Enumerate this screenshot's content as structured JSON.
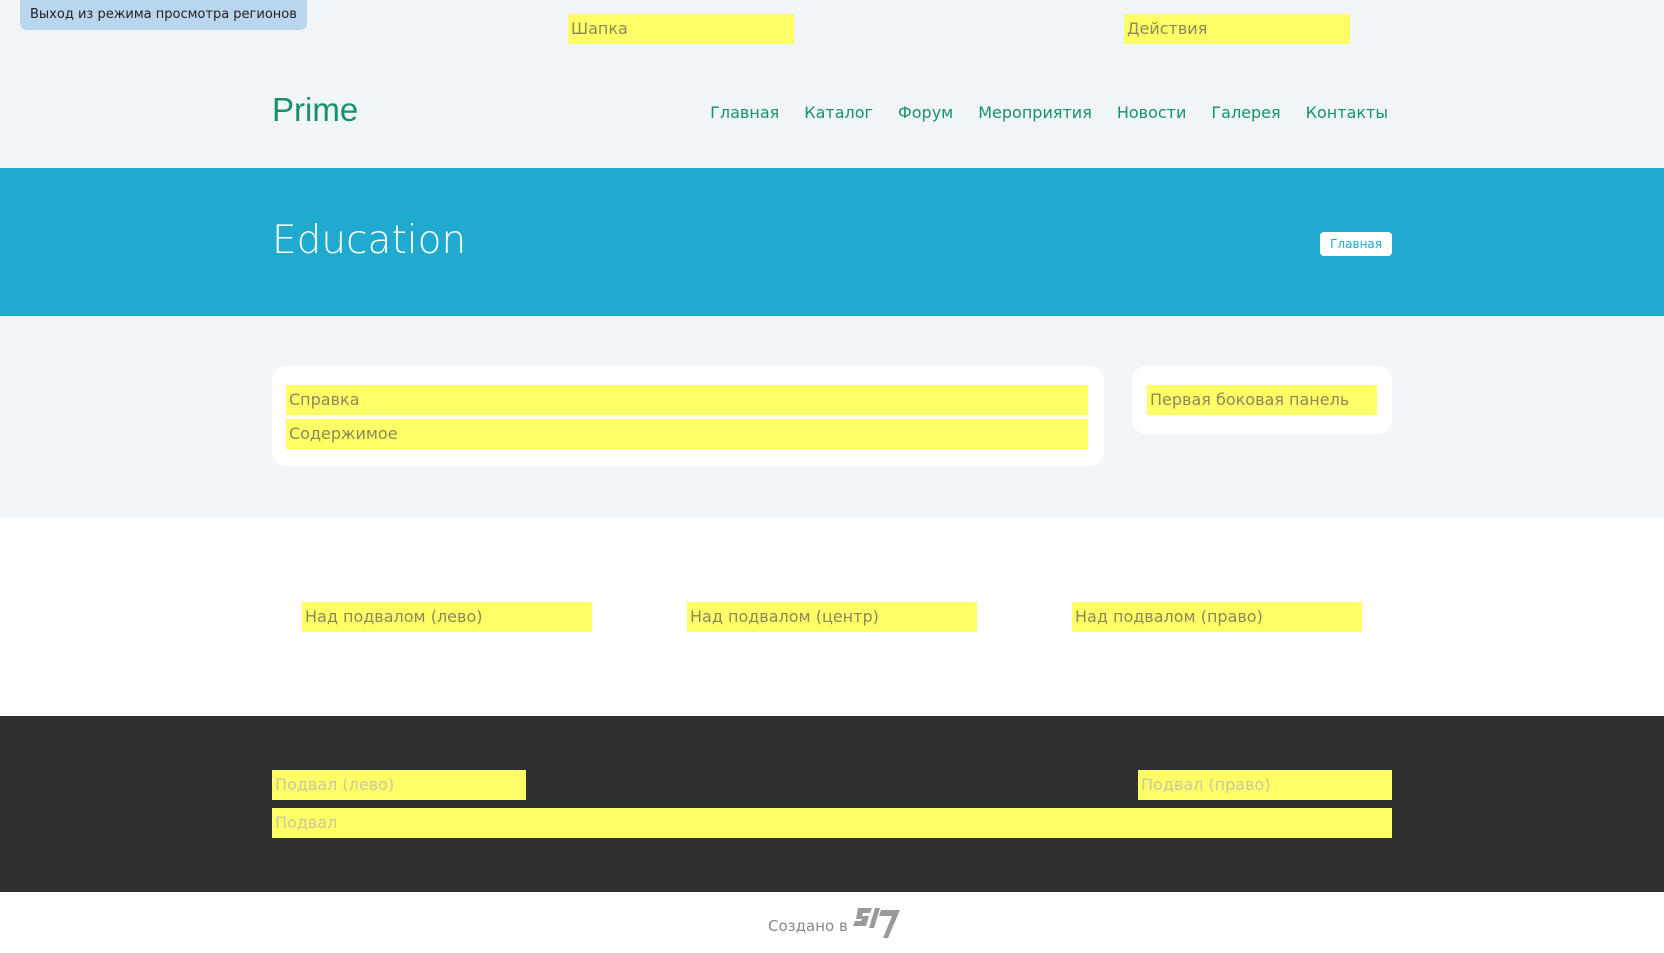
{
  "exit_region_mode": "Выход из режима просмотра регионов",
  "regions": {
    "header": "Шапка",
    "actions": "Действия",
    "help": "Справка",
    "content": "Содержимое",
    "sidebar_first": "Первая боковая панель",
    "prefooter_left": "Над подвалом (лево)",
    "prefooter_center": "Над подвалом (центр)",
    "prefooter_right": "Над подвалом (право)",
    "footer_left": "Подвал (лево)",
    "footer_right": "Подвал (право)",
    "footer": "Подвал"
  },
  "site": {
    "name": "Prime",
    "nav": [
      "Главная",
      "Каталог",
      "Форум",
      "Мероприятия",
      "Новости",
      "Галерея",
      "Контакты"
    ]
  },
  "banner": {
    "title": "Education",
    "breadcrumb": "Главная"
  },
  "credit": {
    "text": "Создано в",
    "logo_icon": "s17-logo-icon"
  },
  "colors": {
    "accent_green": "#159172",
    "banner_blue": "#20aad0",
    "region_yellow": "#ffff66",
    "footer_dark": "#2f312f",
    "light_bg": "#f1f5f8"
  }
}
